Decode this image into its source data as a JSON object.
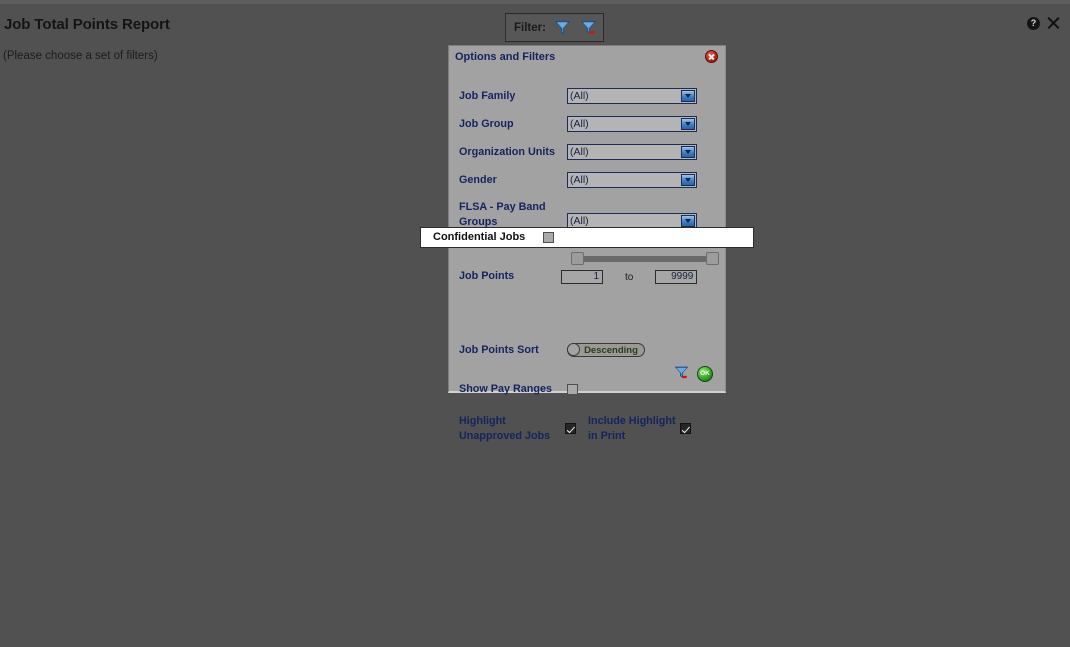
{
  "page": {
    "title": "Job Total Points Report",
    "subtitle": "(Please choose a set of filters)"
  },
  "toolbar": {
    "filter_label": "Filter:",
    "apply_filter_icon": "funnel-icon",
    "clear_filter_icon": "funnel-remove-icon"
  },
  "window_controls": {
    "help_glyph": "?",
    "help_icon": "help-circle-icon",
    "close_icon": "close-x-icon"
  },
  "dialog": {
    "title": "Options and Filters",
    "close_icon": "close-circle-icon",
    "fields": {
      "job_family": {
        "label": "Job Family",
        "value": "(All)"
      },
      "job_group": {
        "label": "Job Group",
        "value": "(All)"
      },
      "organization_units": {
        "label": "Organization Units",
        "value": "(All)"
      },
      "gender": {
        "label": "Gender",
        "value": "(All)"
      },
      "flsa_pay_band_groups": {
        "label": "FLSA - Pay Band Groups",
        "value": "(All)"
      },
      "confidential_jobs": {
        "label": "Confidential Jobs",
        "checked": false
      },
      "job_points": {
        "label": "Job Points",
        "min_value": "1",
        "max_value": "9999",
        "separator": "to"
      },
      "job_points_sort": {
        "label": "Job Points Sort",
        "value": "Descending"
      },
      "show_pay_ranges": {
        "label": "Show Pay Ranges",
        "checked": false
      },
      "highlight_unapproved_jobs": {
        "label": "Highlight Unapproved Jobs",
        "checked": true
      },
      "include_highlight_in_print": {
        "label": "Include Highlight in Print",
        "checked": true
      }
    },
    "actions": {
      "filter_icon": "funnel-remove-icon",
      "ok_label": "OK",
      "ok_icon": "ok-circle-icon"
    }
  },
  "colors": {
    "overlay_background": "#515151",
    "dialog_background": "#a2a2a2",
    "label_blue": "#14245f",
    "accent_blue": "#3f7fc4",
    "ok_green": "#2f9d22",
    "close_red": "#a81c10",
    "highlight_white": "#ffffff"
  }
}
